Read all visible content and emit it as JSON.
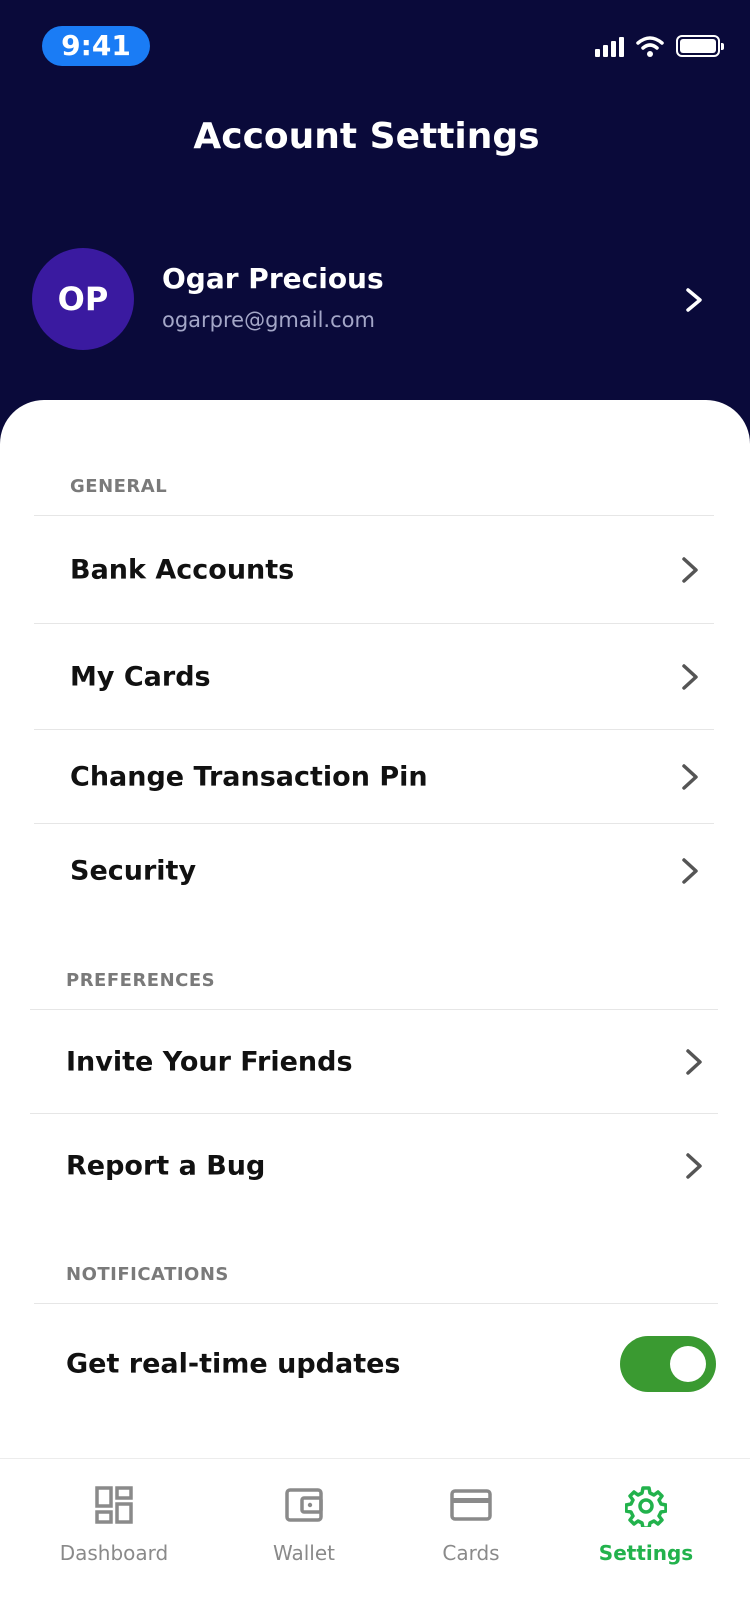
{
  "status_bar": {
    "time": "9:41"
  },
  "header": {
    "title": "Account Settings"
  },
  "profile": {
    "initials": "OP",
    "name": "Ogar Precious",
    "email": "ogarpre@gmail.com"
  },
  "sections": {
    "general": {
      "label": "GENERAL",
      "items": [
        "Bank Accounts",
        "My Cards",
        "Change Transaction Pin",
        "Security"
      ]
    },
    "preferences": {
      "label": "PREFERENCES",
      "items": [
        "Invite Your Friends",
        "Report a Bug"
      ]
    },
    "notifications": {
      "label": "NOTIFICATIONS",
      "toggle_label": "Get real-time updates",
      "toggle_on": true
    }
  },
  "tabbar": {
    "tabs": [
      "Dashboard",
      "Wallet",
      "Cards",
      "Settings"
    ],
    "active": "Settings"
  },
  "colors": {
    "header_bg": "#0a0a3a",
    "avatar_bg": "#3a1aa0",
    "accent_green": "#22b24c",
    "toggle_green": "#3a9a31",
    "time_pill": "#1a7cf5"
  }
}
